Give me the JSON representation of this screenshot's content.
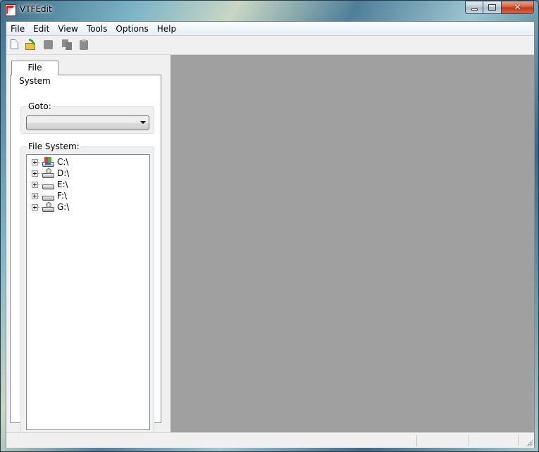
{
  "window": {
    "title": "VTFEdit",
    "close_glyph": "✕"
  },
  "menubar": {
    "items": [
      "File",
      "Edit",
      "View",
      "Tools",
      "Options",
      "Help"
    ]
  },
  "toolbar": {
    "buttons": [
      "new-icon",
      "open-icon",
      "save-icon",
      "copy-icon",
      "paste-icon"
    ]
  },
  "left_panel": {
    "tab_label": "File System",
    "goto": {
      "label": "Goto:",
      "value": ""
    },
    "file_system": {
      "label": "File System:",
      "drives": [
        {
          "label": "C:\\",
          "icon": "system-drive-icon"
        },
        {
          "label": "D:\\",
          "icon": "optical-drive-icon"
        },
        {
          "label": "E:\\",
          "icon": "drive-icon"
        },
        {
          "label": "F:\\",
          "icon": "drive-icon"
        },
        {
          "label": "G:\\",
          "icon": "optical-drive-icon"
        }
      ]
    }
  },
  "viewport": {
    "background": "#a0a0a0"
  }
}
